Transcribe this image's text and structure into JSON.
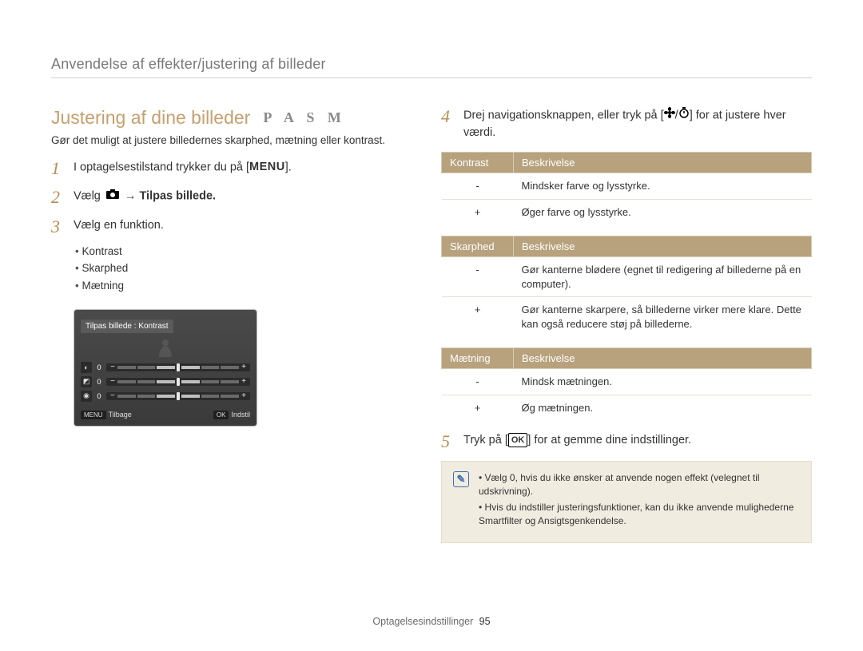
{
  "breadcrumb": "Anvendelse af effekter/justering af billeder",
  "heading": "Justering af dine billeder",
  "mode_label": "P A S M",
  "subdesc": "Gør det muligt at justere billedernes skarphed, mætning eller kontrast.",
  "steps": {
    "s1": {
      "num": "1",
      "pre": "I optagelsestilstand trykker du på [",
      "icon": "MENU",
      "post": "]."
    },
    "s2": {
      "num": "2",
      "pre": "Vælg ",
      "post": " → Tilpas billede."
    },
    "s3": {
      "num": "3",
      "text": "Vælg en funktion."
    },
    "s4": {
      "num": "4",
      "pre": "Drej navigationsknappen, eller tryk på [",
      "post": "] for at justere hver værdi."
    },
    "s5": {
      "num": "5",
      "pre": "Tryk på [",
      "btn": "OK",
      "post": "] for at gemme dine indstillinger."
    }
  },
  "bullets": [
    "Kontrast",
    "Skarphed",
    "Mætning"
  ],
  "cam_title": "Tilpas billede : Kontrast",
  "cam_footer_back": "Tilbage",
  "cam_footer_set": "Indstil",
  "cam_back_chip": "MENU",
  "cam_set_chip": "OK",
  "slider_value": "0",
  "tables": {
    "kontrast": {
      "h1": "Kontrast",
      "h2": "Beskrivelse",
      "rows": [
        {
          "k": "-",
          "v": "Mindsker farve og lysstyrke."
        },
        {
          "k": "+",
          "v": "Øger farve og lysstyrke."
        }
      ]
    },
    "skarphed": {
      "h1": "Skarphed",
      "h2": "Beskrivelse",
      "rows": [
        {
          "k": "-",
          "v": "Gør kanterne blødere (egnet til redigering af billederne på en computer)."
        },
        {
          "k": "+",
          "v": "Gør kanterne skarpere, så billederne virker mere klare. Dette kan også reducere støj på billederne."
        }
      ]
    },
    "maetning": {
      "h1": "Mætning",
      "h2": "Beskrivelse",
      "rows": [
        {
          "k": "-",
          "v": "Mindsk mætningen."
        },
        {
          "k": "+",
          "v": "Øg mætningen."
        }
      ]
    }
  },
  "notes": [
    "Vælg 0, hvis du ikke ønsker at anvende nogen effekt (velegnet til udskrivning).",
    "Hvis du indstiller justeringsfunktioner, kan du ikke anvende mulighederne Smartfilter og Ansigtsgenkendelse."
  ],
  "footer_section": "Optagelsesindstillinger",
  "footer_page": "95"
}
